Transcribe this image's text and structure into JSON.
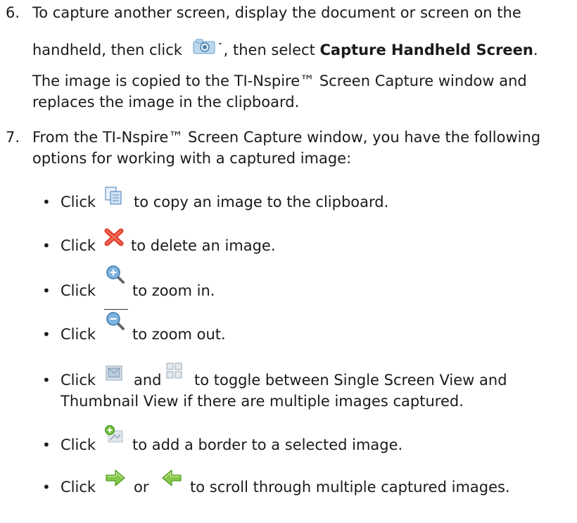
{
  "step6": {
    "number": "6.",
    "line1": "To capture another screen, display the document or screen on the",
    "line2_pre": "handheld, then click",
    "line2_mid": ", then select",
    "line2_bold": "Capture Handheld Screen",
    "line2_end": ".",
    "para_line1": "The image is copied to the TI-Nspire™ Screen Capture window and",
    "para_line2": "replaces the image in the clipboard."
  },
  "step7": {
    "number": "7.",
    "line1": "From the TI-Nspire™ Screen Capture window, you have the following",
    "line2": "options for working with a captured image:"
  },
  "bullets": {
    "symbol": "•",
    "click": "Click",
    "copy_text": "to copy an image to the clipboard.",
    "delete_text": "to delete an image.",
    "zoom_in_text": "to zoom in.",
    "zoom_out_text": "to zoom out.",
    "and": "and",
    "toggle_text_1": "to toggle between Single Screen View and",
    "toggle_text_2": "Thumbnail View if there are multiple images captured.",
    "border_text": "to add a border to a selected image.",
    "or": "or",
    "scroll_text": "to scroll through multiple captured images."
  },
  "icons": {
    "camera": "camera-capture-icon",
    "copy": "copy-icon",
    "delete": "delete-icon",
    "zoom_in": "zoom-in-icon",
    "zoom_out": "zoom-out-icon",
    "single_view": "single-screen-view-icon",
    "thumbnail_view": "thumbnail-view-icon",
    "add_border": "add-border-icon",
    "next": "next-arrow-icon",
    "previous": "previous-arrow-icon"
  },
  "colors": {
    "text": "#1a1a1a",
    "delete_red": "#e03a2a",
    "arrow_green": "#7cc23a",
    "zoom_blue": "#4a8fc8"
  }
}
